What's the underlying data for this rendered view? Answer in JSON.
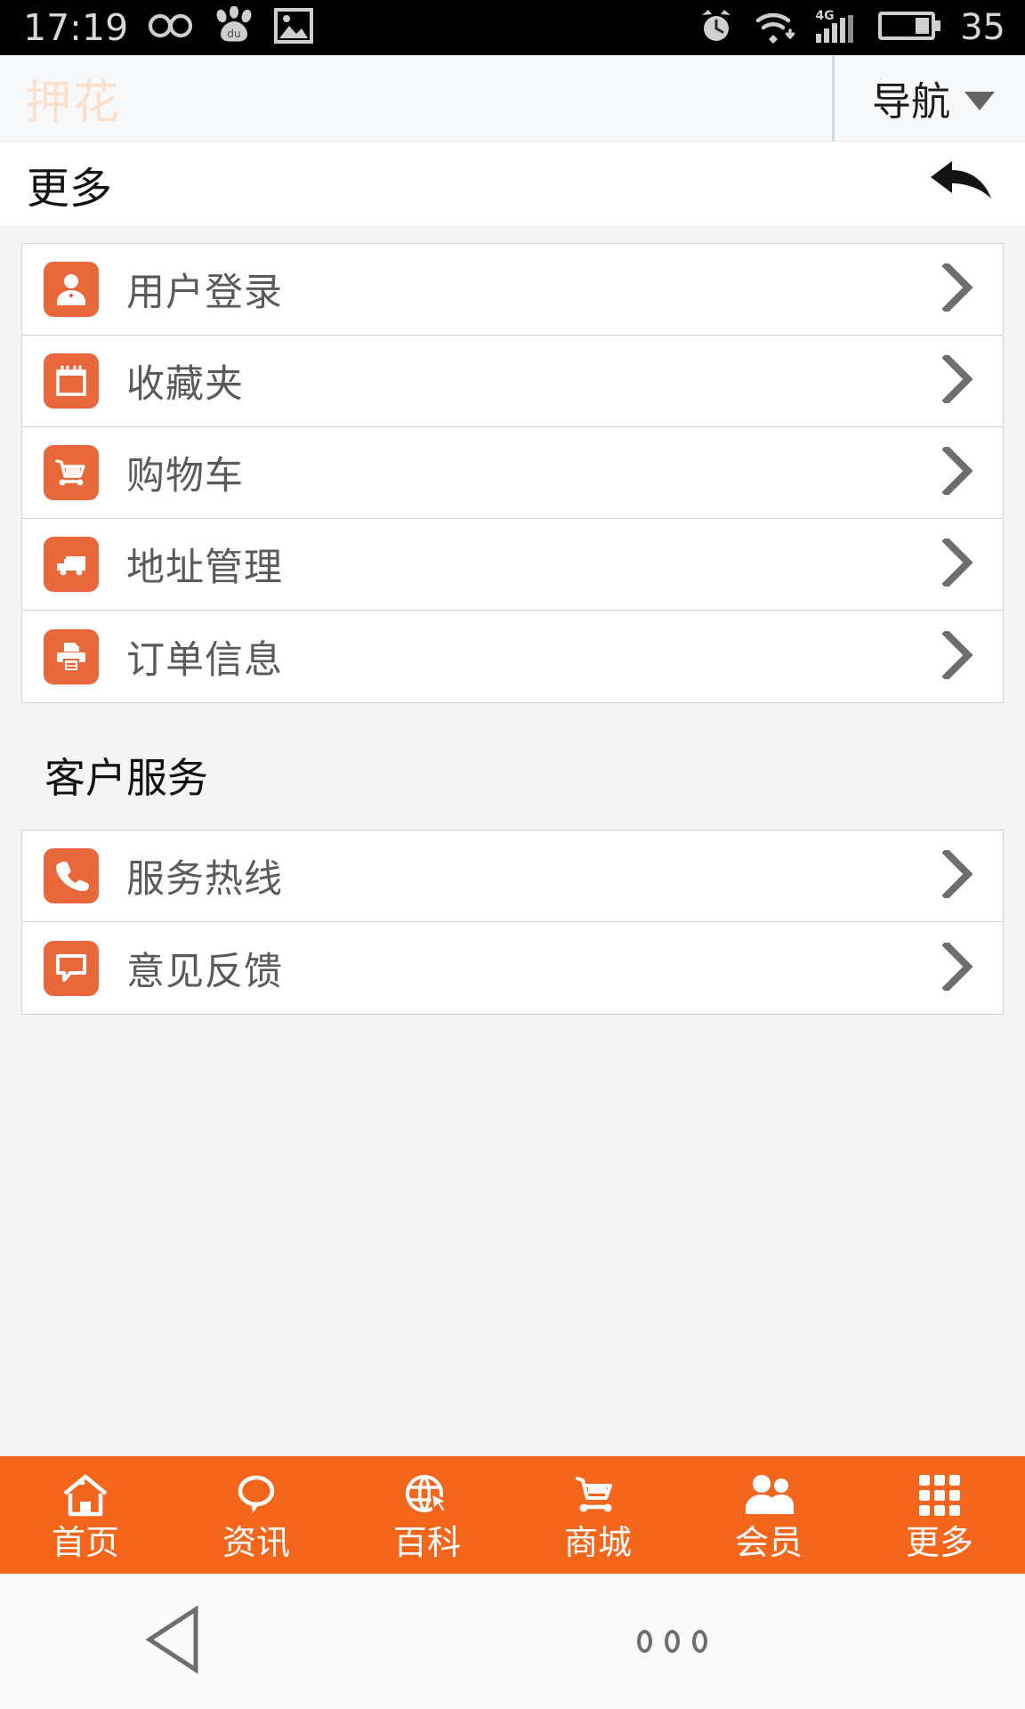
{
  "statusbar": {
    "time": "17:19",
    "battery_percent": "35",
    "left_icons": [
      "infinity-icon",
      "baidu-paw-icon",
      "image-icon"
    ],
    "right_icons": [
      "alarm-clock-icon",
      "wifi-icon",
      "signal-4g-icon",
      "battery-icon"
    ],
    "network_label": "4G"
  },
  "appheader": {
    "brand": "押花",
    "nav_label": "导航",
    "nav_caret": "chevron-down-icon"
  },
  "titlebar": {
    "title": "更多",
    "back_icon": "back-arrow-icon"
  },
  "account_section": {
    "items": [
      {
        "label": "用户登录",
        "icon": "user-icon"
      },
      {
        "label": "收藏夹",
        "icon": "calendar-icon"
      },
      {
        "label": "购物车",
        "icon": "shopping-cart-icon"
      },
      {
        "label": "地址管理",
        "icon": "truck-icon"
      },
      {
        "label": "订单信息",
        "icon": "printer-icon"
      }
    ]
  },
  "service_section": {
    "heading": "客户服务",
    "items": [
      {
        "label": "服务热线",
        "icon": "phone-icon"
      },
      {
        "label": "意见反馈",
        "icon": "speech-bubble-icon"
      }
    ]
  },
  "tabbar": {
    "items": [
      {
        "label": "首页",
        "icon": "home-icon"
      },
      {
        "label": "资讯",
        "icon": "chat-icon"
      },
      {
        "label": "百科",
        "icon": "globe-cursor-icon"
      },
      {
        "label": "商城",
        "icon": "cart-icon"
      },
      {
        "label": "会员",
        "icon": "people-icon"
      },
      {
        "label": "更多",
        "icon": "grid-icon"
      }
    ]
  },
  "androidnav": {
    "back_icon": "triangle-back-icon",
    "menu_icon": "three-dots-icon"
  },
  "colors": {
    "accent": "#f4661c",
    "icon_tile": "#e8683c",
    "brand_text": "#fbe0cb",
    "row_label": "#5a5a5a",
    "chevron": "#6e6e6e"
  }
}
